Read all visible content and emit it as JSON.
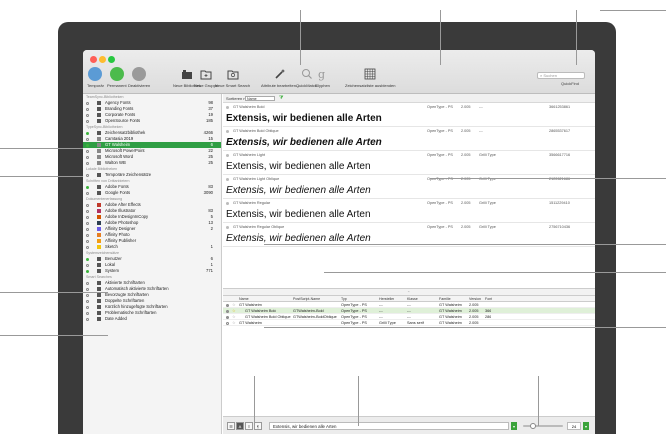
{
  "toolbar": {
    "buttons": [
      {
        "label": "Temporär",
        "color": "#5b9bd5"
      },
      {
        "label": "Permanent",
        "color": "#4cbb4c"
      },
      {
        "label": "Deaktivieren",
        "color": "#9a9a9a"
      },
      {
        "label": "Neue Bibliothek",
        "icon": "library-icon"
      },
      {
        "label": "Neue Gruppe",
        "icon": "folder-plus-icon"
      },
      {
        "label": "Neue Smart Search",
        "icon": "smart-folder-icon"
      },
      {
        "label": "Attribute bearbeiten...",
        "icon": "wand-icon"
      },
      {
        "label": "QuickMatch",
        "icon": "zoom-icon"
      },
      {
        "label": "Glyphen",
        "icon": "glyph-icon"
      },
      {
        "label": "Zeichensatzliste ausblenden",
        "icon": "grid-icon"
      }
    ],
    "search_placeholder": "Suchen",
    "search_label": "QuickFind"
  },
  "sidebar": {
    "sections": [
      {
        "title": "TeamSync-Bibliotheken",
        "items": [
          {
            "label": "Agency Fonts",
            "count": "98"
          },
          {
            "label": "Branding Fonts",
            "count": "37"
          },
          {
            "label": "Corporate Fonts",
            "count": "19"
          },
          {
            "label": "OpenSource Fonts",
            "count": "185"
          }
        ]
      },
      {
        "title": "TypeSync-Bibliotheken",
        "items": [
          {
            "label": "Zeichensatzbibliothek",
            "count": "4266"
          },
          {
            "label": "Camtasia 2019",
            "count": "15"
          },
          {
            "label": "GT Walsheim",
            "count": "6",
            "selected": true
          },
          {
            "label": "Microsoft PowerPoint",
            "count": "22"
          },
          {
            "label": "Microsoft Word",
            "count": "25"
          },
          {
            "label": "Walton WB",
            "count": "25"
          }
        ]
      },
      {
        "title": "Lokale Bibliotheken",
        "items": [
          {
            "label": "Temporäre Zeichensätze",
            "count": ""
          }
        ]
      },
      {
        "title": "Schriften von Drittanbietern",
        "items": [
          {
            "label": "Adobe Fonts",
            "count": "83"
          },
          {
            "label": "Google Fonts",
            "count": "3090"
          }
        ]
      },
      {
        "title": "Dokumentenerfassung",
        "items": [
          {
            "label": "Adobe After Effects",
            "count": ""
          },
          {
            "label": "Adobe Illustrator",
            "count": "83"
          },
          {
            "label": "Adobe InDesignInCopy",
            "count": "5"
          },
          {
            "label": "Adobe Photoshop",
            "count": "13"
          },
          {
            "label": "Affinity Designer",
            "count": "2"
          },
          {
            "label": "Affinity Photo",
            "count": ""
          },
          {
            "label": "Affinity Publisher",
            "count": ""
          },
          {
            "label": "Sketch",
            "count": "1"
          }
        ]
      },
      {
        "title": "Systemzeichensätze",
        "items": [
          {
            "label": "Benutzer",
            "count": "6"
          },
          {
            "label": "Lokal",
            "count": "1"
          },
          {
            "label": "System",
            "count": "771"
          }
        ]
      },
      {
        "title": "Smart Searches",
        "items": [
          {
            "label": "Aktivierte Schriftarten",
            "count": ""
          },
          {
            "label": "Automatisch aktivierte Schriftarten",
            "count": ""
          },
          {
            "label": "Bevorzugte Schriftarten",
            "count": ""
          },
          {
            "label": "Doppelte Schriftarten",
            "count": ""
          },
          {
            "label": "Kürzlich hinzugefügte Schriftarten",
            "count": ""
          },
          {
            "label": "Problematische Schriftarten",
            "count": ""
          },
          {
            "label": "Date Added",
            "count": ""
          }
        ]
      }
    ]
  },
  "sortbar": {
    "label": "Sortieren nach:",
    "value": "Name"
  },
  "preview": {
    "sample": "Extensis, wir bedienen alle Arten",
    "items": [
      {
        "name": "GT Walsheim Bold",
        "type": "OpenType - PS",
        "version": "2.005",
        "cls": "---",
        "id": "3661253861",
        "weight": "700",
        "style": "normal"
      },
      {
        "name": "GT Walsheim Bold Oblique",
        "type": "OpenType - PS",
        "version": "2.005",
        "cls": "---",
        "id": "2865537617",
        "weight": "700",
        "style": "italic"
      },
      {
        "name": "GT Walsheim Light",
        "type": "OpenType - PS",
        "version": "2.005",
        "cls": "Grilli Type",
        "id": "3566617716",
        "weight": "300",
        "style": "normal"
      },
      {
        "name": "GT Walsheim Light Oblique",
        "type": "OpenType - PS",
        "version": "2.005",
        "cls": "Grilli Type",
        "id": "2122621686",
        "weight": "300",
        "style": "italic"
      },
      {
        "name": "GT Walsheim Regular",
        "type": "OpenType - PS",
        "version": "2.005",
        "cls": "Grilli Type",
        "id": "1511229410",
        "weight": "400",
        "style": "normal"
      },
      {
        "name": "GT Walsheim Regular Oblique",
        "type": "OpenType - PS",
        "version": "2.005",
        "cls": "Grilli Type",
        "id": "2756710436",
        "weight": "400",
        "style": "italic"
      }
    ]
  },
  "grid": {
    "headers": [
      "Name",
      "PostScript-Name",
      "Typ",
      "Hersteller",
      "Klasse",
      "Familie",
      "Version",
      "Font"
    ],
    "rows": [
      {
        "name": "GT Walsheim",
        "ps": "",
        "type": "OpenType - PS",
        "maker": "---",
        "cls": "---",
        "family": "GT Walsheim",
        "version": "2.005",
        "font": "",
        "indent": 0,
        "sel": false
      },
      {
        "name": "GT Walsheim Bold",
        "ps": "GTWalsheim-Bold",
        "type": "OpenType - PS",
        "maker": "---",
        "cls": "---",
        "family": "GT Walsheim",
        "version": "2.005",
        "font": "366",
        "indent": 1,
        "sel": true
      },
      {
        "name": "GT Walsheim Bold Oblique",
        "ps": "GTWalsheim-BoldOblique",
        "type": "OpenType - PS",
        "maker": "---",
        "cls": "---",
        "family": "GT Walsheim",
        "version": "2.005",
        "font": "286",
        "indent": 1,
        "sel": false
      },
      {
        "name": "GT Walsheim",
        "ps": "",
        "type": "OpenType - PS",
        "maker": "Grilli Type",
        "cls": "Sans serif",
        "family": "GT Walsheim",
        "version": "2.005",
        "font": "",
        "indent": 0,
        "sel": false
      }
    ]
  },
  "bottombar": {
    "sample_text": "Extensis, wir bedienen alle Arten",
    "size": "24",
    "size_slider_fraction": 0.2
  }
}
